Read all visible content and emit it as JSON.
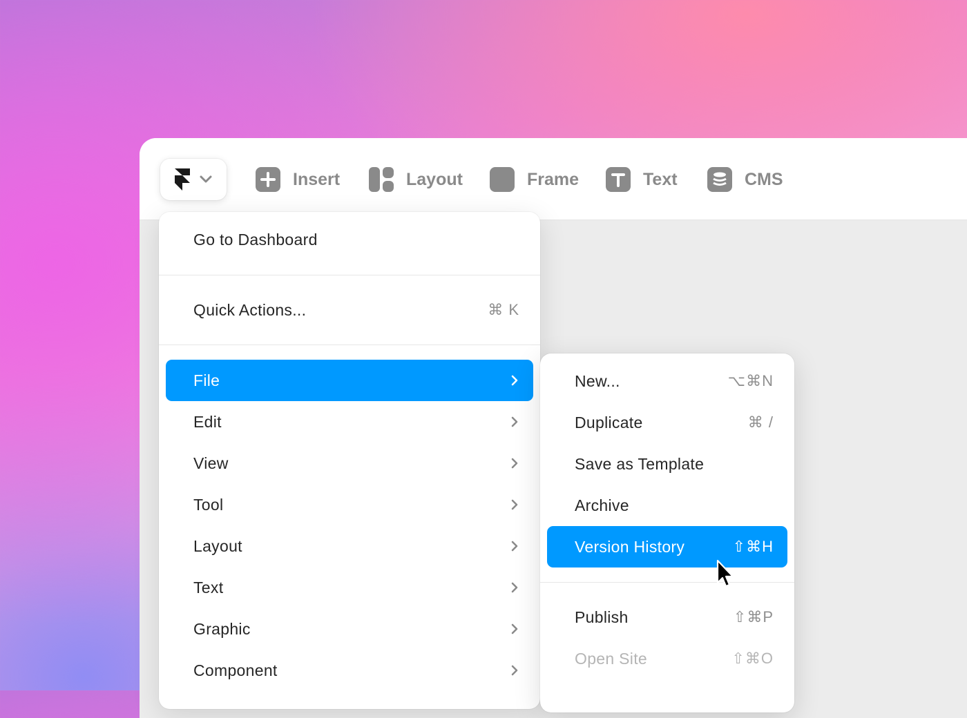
{
  "toolbar": {
    "logo_icon": "framer-logo-icon",
    "tools": [
      {
        "label": "Insert",
        "icon": "plus-square-icon"
      },
      {
        "label": "Layout",
        "icon": "layout-icon"
      },
      {
        "label": "Frame",
        "icon": "frame-icon"
      },
      {
        "label": "Text",
        "icon": "text-t-icon"
      },
      {
        "label": "CMS",
        "icon": "database-icon"
      }
    ]
  },
  "menu": {
    "dashboard": {
      "label": "Go to Dashboard"
    },
    "quick_actions": {
      "label": "Quick Actions...",
      "shortcut": "⌘ K"
    },
    "items": [
      {
        "label": "File",
        "active": true
      },
      {
        "label": "Edit"
      },
      {
        "label": "View"
      },
      {
        "label": "Tool"
      },
      {
        "label": "Layout"
      },
      {
        "label": "Text"
      },
      {
        "label": "Graphic"
      },
      {
        "label": "Component"
      }
    ]
  },
  "submenu": {
    "items": [
      {
        "label": "New...",
        "shortcut": "⌥⌘N"
      },
      {
        "label": "Duplicate",
        "shortcut": "⌘ /"
      },
      {
        "label": "Save as Template",
        "shortcut": ""
      },
      {
        "label": "Archive",
        "shortcut": ""
      },
      {
        "label": "Version History",
        "shortcut": "⇧⌘H",
        "active": true
      },
      {
        "label": "Publish",
        "shortcut": "⇧⌘P"
      },
      {
        "label": "Open Site",
        "shortcut": "⇧⌘O",
        "disabled": true
      }
    ]
  },
  "colors": {
    "accent": "#0099ff",
    "icon_gray": "#8a8a8a",
    "text": "#262626",
    "shortcut": "#8f8f8f"
  }
}
